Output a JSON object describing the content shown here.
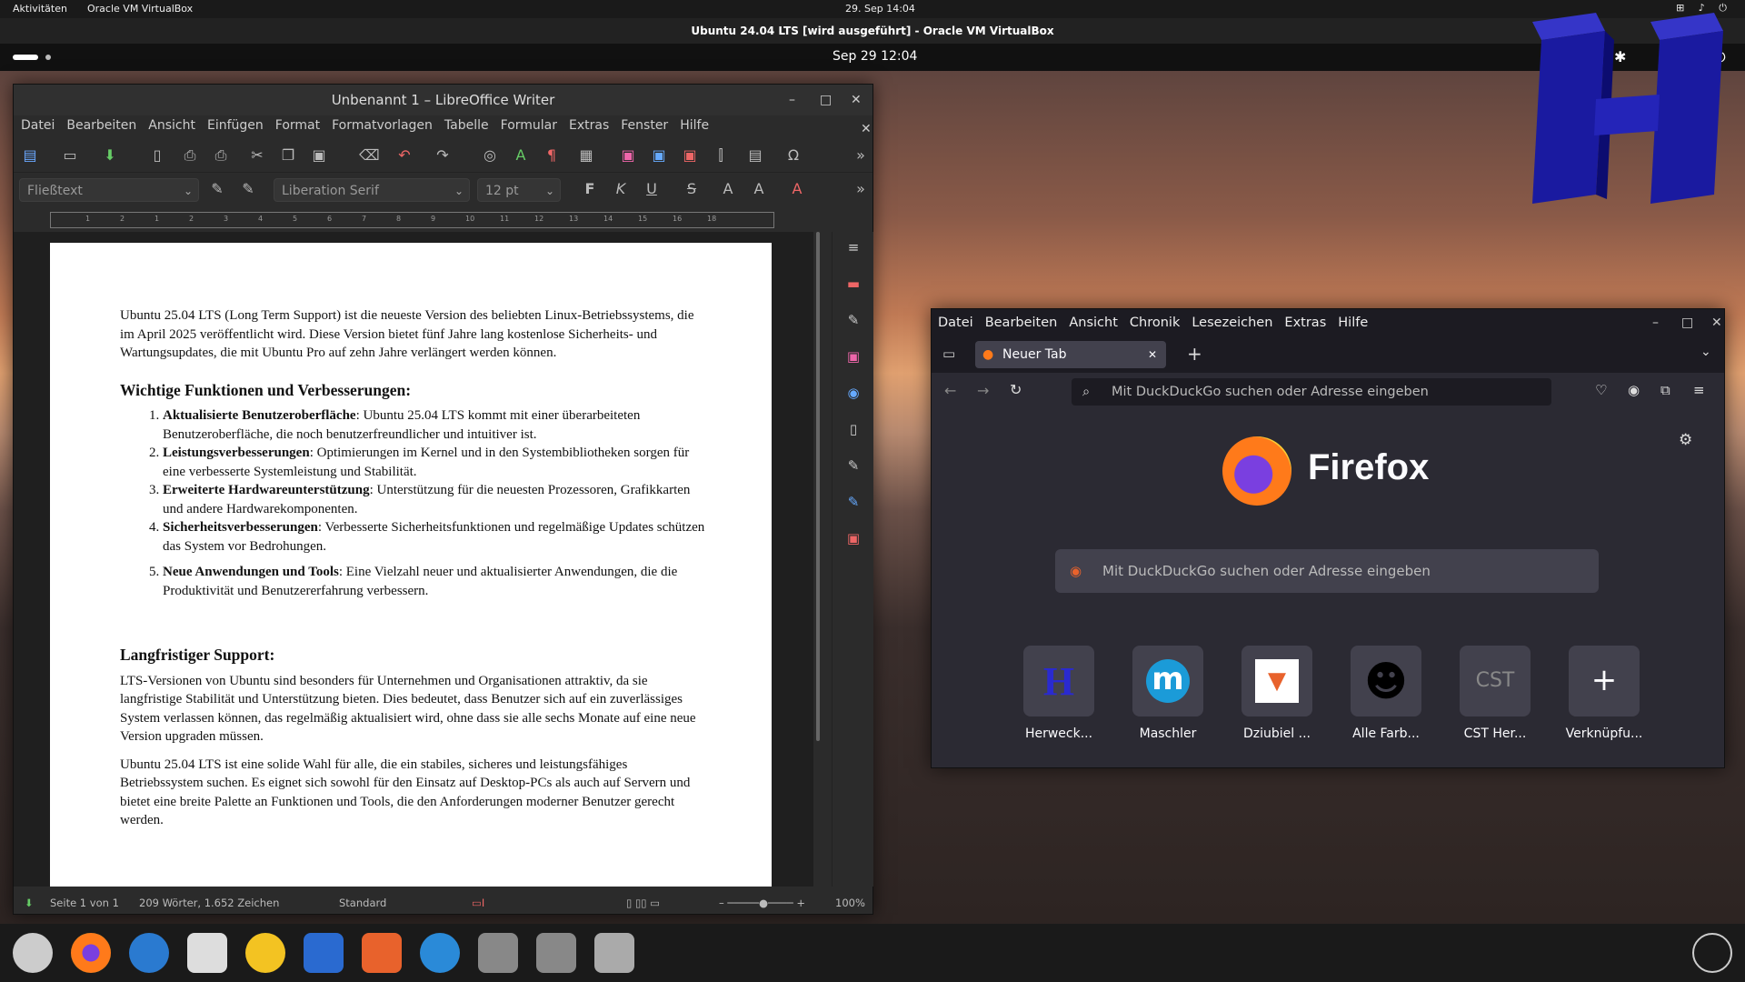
{
  "host_bar": {
    "activities": "Aktivitäten",
    "app": "Oracle VM VirtualBox",
    "clock": "29. Sep  14:04"
  },
  "vbox_title": "Ubuntu 24.04 LTS [wird ausgeführt] - Oracle VM VirtualBox",
  "guest_bar": {
    "clock": "Sep 29  12:04"
  },
  "writer": {
    "title": "Unbenannt 1 – LibreOffice Writer",
    "menu": [
      "Datei",
      "Bearbeiten",
      "Ansicht",
      "Einfügen",
      "Format",
      "Formatvorlagen",
      "Tabelle",
      "Formular",
      "Extras",
      "Fenster",
      "Hilfe"
    ],
    "paragraph_style": "Fließtext",
    "font_name": "Liberation Serif",
    "font_size": "12 pt",
    "ruler_ticks": [
      "1",
      "2",
      "1",
      "2",
      "3",
      "4",
      "5",
      "6",
      "7",
      "8",
      "9",
      "10",
      "11",
      "12",
      "13",
      "14",
      "15",
      "16",
      "18"
    ],
    "doc": {
      "intro": "Ubuntu 25.04 LTS (Long Term Support) ist die neueste Version des beliebten Linux-Betriebssystems, die im April 2025 veröffentlicht wird. Diese Version bietet fünf Jahre lang kostenlose Sicherheits- und Wartungsupdates, die mit Ubuntu Pro auf zehn Jahre verlängert werden können.",
      "h1": "Wichtige Funktionen und Verbesserungen:",
      "items": [
        {
          "bold": "Aktualisierte Benutzeroberfläche",
          "text": ": Ubuntu 25.04 LTS kommt mit einer überarbeiteten Benutzeroberfläche, die noch benutzerfreundlicher und intuitiver ist."
        },
        {
          "bold": "Leistungsverbesserungen",
          "text": ": Optimierungen im Kernel und in den Systembibliotheken sorgen für eine verbesserte Systemleistung und Stabilität."
        },
        {
          "bold": "Erweiterte Hardwareunterstützung",
          "text": ": Unterstützung für die neuesten Prozessoren, Grafikkarten und andere Hardwarekomponenten."
        },
        {
          "bold": "Sicherheitsverbesserungen",
          "text": ": Verbesserte Sicherheitsfunktionen und regelmäßige Updates schützen das System vor Bedrohungen."
        },
        {
          "bold": "Neue Anwendungen und Tools",
          "text": ": Eine Vielzahl neuer und aktualisierter Anwendungen, die die Produktivität und Benutzererfahrung verbessern."
        }
      ],
      "h2": "Langfristiger Support:",
      "p2": "LTS-Versionen von Ubuntu sind besonders für Unternehmen und Organisationen attraktiv, da sie langfristige Stabilität und Unterstützung bieten. Dies bedeutet, dass Benutzer sich auf ein zuverlässiges System verlassen können, das regelmäßig aktualisiert wird, ohne dass sie alle sechs Monate auf eine neue Version upgraden müssen.",
      "p3": "Ubuntu 25.04 LTS ist eine solide Wahl für alle, die ein stabiles, sicheres und leistungsfähiges Betriebssystem suchen. Es eignet sich sowohl für den Einsatz auf Desktop-PCs als auch auf Servern und bietet eine breite Palette an Funktionen und Tools, die den Anforderungen moderner Benutzer gerecht werden."
    },
    "status": {
      "page": "Seite 1 von 1",
      "words": "209 Wörter, 1.652 Zeichen",
      "style": "Standard",
      "zoom": "100%"
    }
  },
  "firefox": {
    "menu": [
      "Datei",
      "Bearbeiten",
      "Ansicht",
      "Chronik",
      "Lesezeichen",
      "Extras",
      "Hilfe"
    ],
    "tab_title": "Neuer Tab",
    "url_placeholder": "Mit DuckDuckGo suchen oder Adresse eingeben",
    "brand": "Firefox",
    "search_placeholder": "Mit DuckDuckGo suchen oder Adresse eingeben",
    "tiles": [
      {
        "label": "Herweck...",
        "glyph": "H",
        "color": "#2a2ad0"
      },
      {
        "label": "Maschler",
        "glyph": "m",
        "color": "#1b9bd8"
      },
      {
        "label": "Dziubiel ...",
        "glyph": "▼",
        "color": "#e8622c"
      },
      {
        "label": "Alle Farb...",
        "glyph": "☻",
        "color": "#000000"
      },
      {
        "label": "CST Her...",
        "glyph": "CST",
        "color": "#888888"
      },
      {
        "label": "Verknüpfu...",
        "glyph": "+",
        "color": "#fbfbfe"
      }
    ]
  }
}
